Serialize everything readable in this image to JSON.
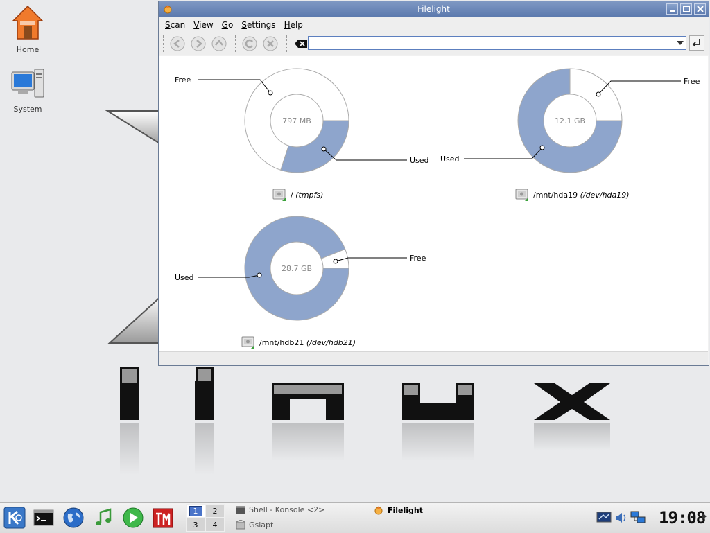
{
  "desktop": {
    "icons": [
      {
        "label": "Home"
      },
      {
        "label": "System"
      }
    ],
    "wallpaper_text": "linux"
  },
  "window": {
    "title": "Filelight",
    "menu": [
      {
        "label": "Scan",
        "accel": "S",
        "rest": "can"
      },
      {
        "label": "View",
        "accel": "V",
        "rest": "iew"
      },
      {
        "label": "Go",
        "accel": "G",
        "rest": "o"
      },
      {
        "label": "Settings",
        "accel": "S",
        "rest": "ettings"
      },
      {
        "label": "Help",
        "accel": "H",
        "rest": "elp"
      }
    ],
    "url_value": "",
    "filesystems": [
      {
        "size": "797 MB",
        "mount": "/",
        "device": "(tmpfs)",
        "used_fraction": 0.3,
        "free_label": "Free",
        "used_label": "Used"
      },
      {
        "size": "12.1 GB",
        "mount": "/mnt/hda19",
        "device": "(/dev/hda19)",
        "used_fraction": 0.75,
        "free_label": "Free",
        "used_label": "Used"
      },
      {
        "size": "28.7 GB",
        "mount": "/mnt/hdb21",
        "device": "(/dev/hdb21)",
        "used_fraction": 0.94,
        "free_label": "Free",
        "used_label": "Used"
      }
    ]
  },
  "taskbar": {
    "pager": [
      "1",
      "2",
      "3",
      "4"
    ],
    "tasks": [
      {
        "label": "Shell - Konsole <2>"
      },
      {
        "label": "Gslapt"
      },
      {
        "label": "Filelight"
      }
    ],
    "clock": "19:08"
  },
  "colors": {
    "used": "#8ea5cc",
    "free": "#ffffff",
    "title_bar": "#6a86b8"
  }
}
